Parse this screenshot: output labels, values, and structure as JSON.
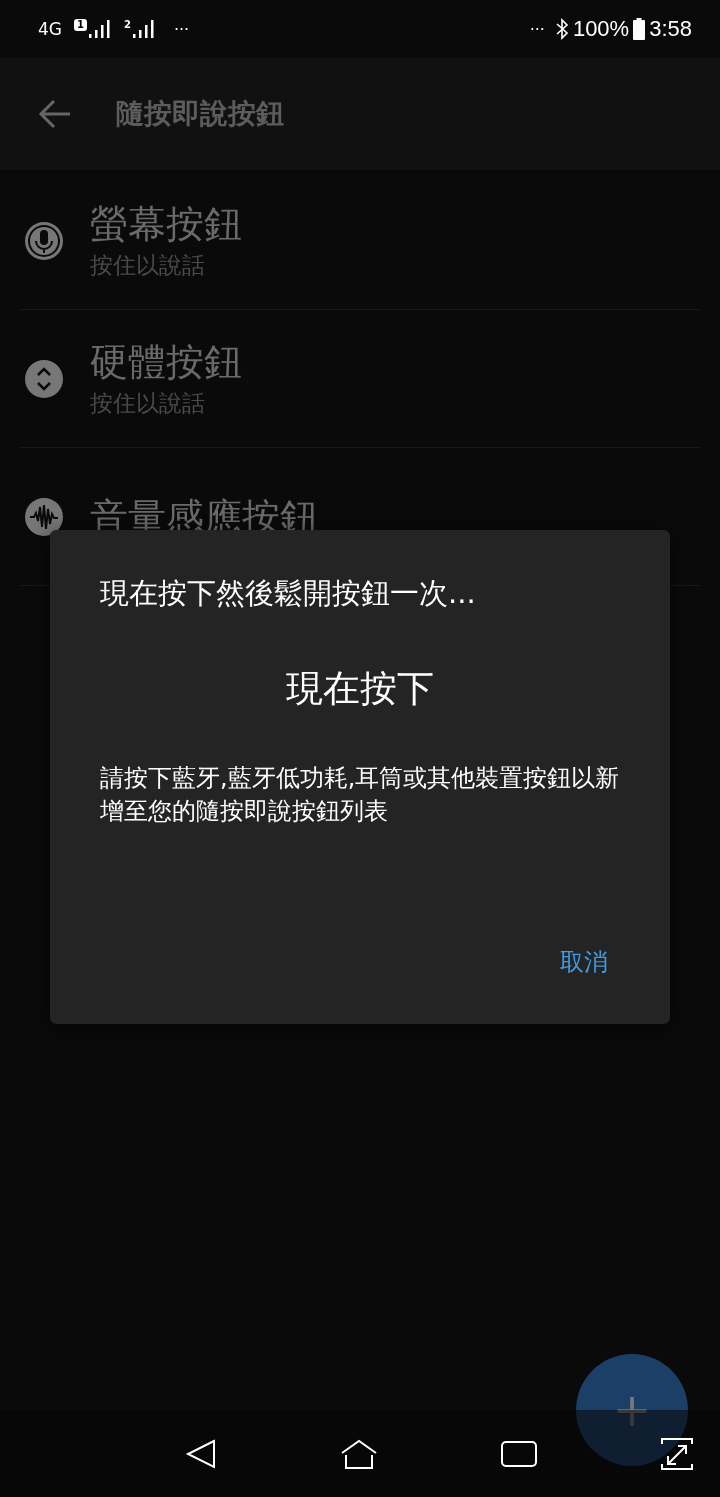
{
  "status_bar": {
    "network": "4G",
    "sim_1": "1",
    "sim_2": "2",
    "more_left": "···",
    "more_right": "···",
    "battery": "100%",
    "time": "3:58"
  },
  "app_bar": {
    "title": "隨按即說按鈕"
  },
  "items": [
    {
      "kind": "mic",
      "title": "螢幕按鈕",
      "subtitle": "按住以說話"
    },
    {
      "kind": "hardware",
      "title": "硬體按鈕",
      "subtitle": "按住以說話"
    },
    {
      "kind": "sound",
      "title": "音量感應按鈕"
    }
  ],
  "dialog": {
    "title": "現在按下然後鬆開按鈕一次...",
    "status": "現在按下",
    "message": "請按下藍牙,藍牙低功耗,耳筒或其他裝置按鈕以新增至您的隨按即說按鈕列表",
    "buttons": [
      "取消"
    ]
  },
  "fab": {
    "label": "+"
  }
}
